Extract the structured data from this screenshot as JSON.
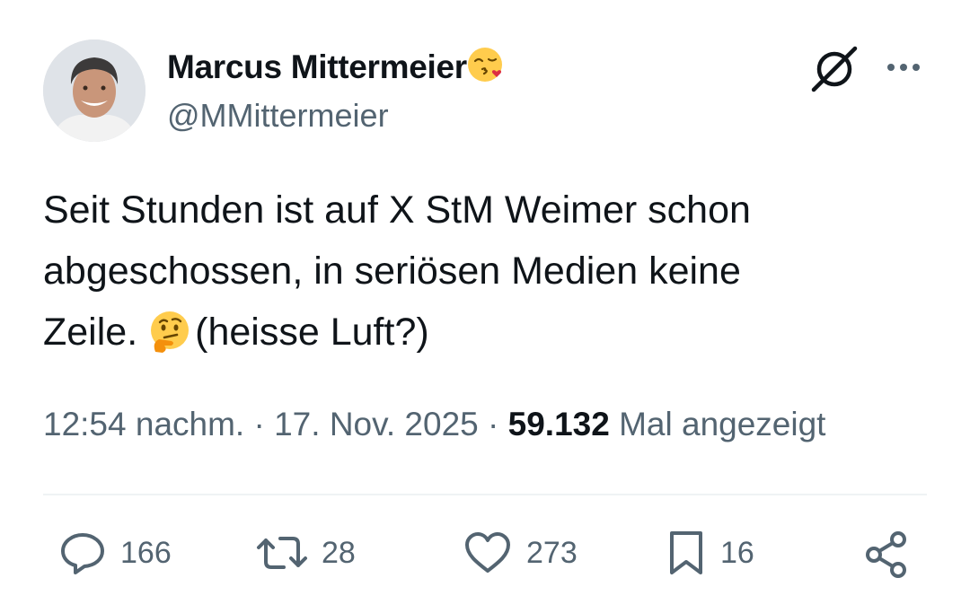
{
  "user": {
    "display_name": "Marcus Mittermeier",
    "handle": "@MMittermeier",
    "name_emoji": "kissing-face-with-heart"
  },
  "tweet": {
    "line1": "Seit Stunden ist auf X StM Weimer schon",
    "line2": "abgeschossen, in seriösen Medien keine",
    "line3_before": "Zeile.",
    "line3_emoji": "thinking-face",
    "line3_after": "(heisse Luft?)"
  },
  "meta": {
    "time": "12:54 nachm.",
    "separator": "·",
    "date": "17. Nov. 2025",
    "views_count": "59.132",
    "views_label": "Mal angezeigt"
  },
  "actions": {
    "replies": "166",
    "reposts": "28",
    "likes": "273",
    "bookmarks": "16"
  },
  "colors": {
    "text": "#0f1419",
    "secondary": "#536471",
    "divider": "#eff3f4"
  }
}
